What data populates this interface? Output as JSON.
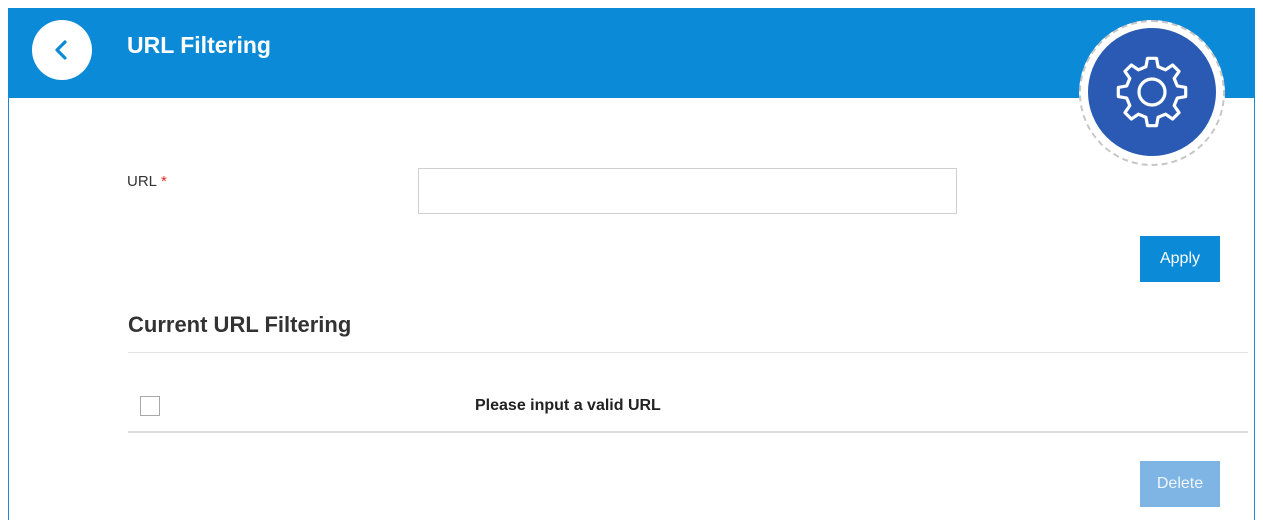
{
  "header": {
    "title": "URL Filtering",
    "back_icon": "chevron-left-icon",
    "settings_icon": "gear-icon",
    "bg_color": "#0b8ad8"
  },
  "form": {
    "url_label": "URL",
    "required_mark": "*",
    "url_value": "",
    "url_placeholder": "",
    "apply_label": "Apply"
  },
  "list": {
    "section_title": "Current URL Filtering",
    "empty_message": "Please input a valid URL",
    "select_all_checked": false,
    "delete_label": "Delete",
    "delete_enabled": false
  }
}
